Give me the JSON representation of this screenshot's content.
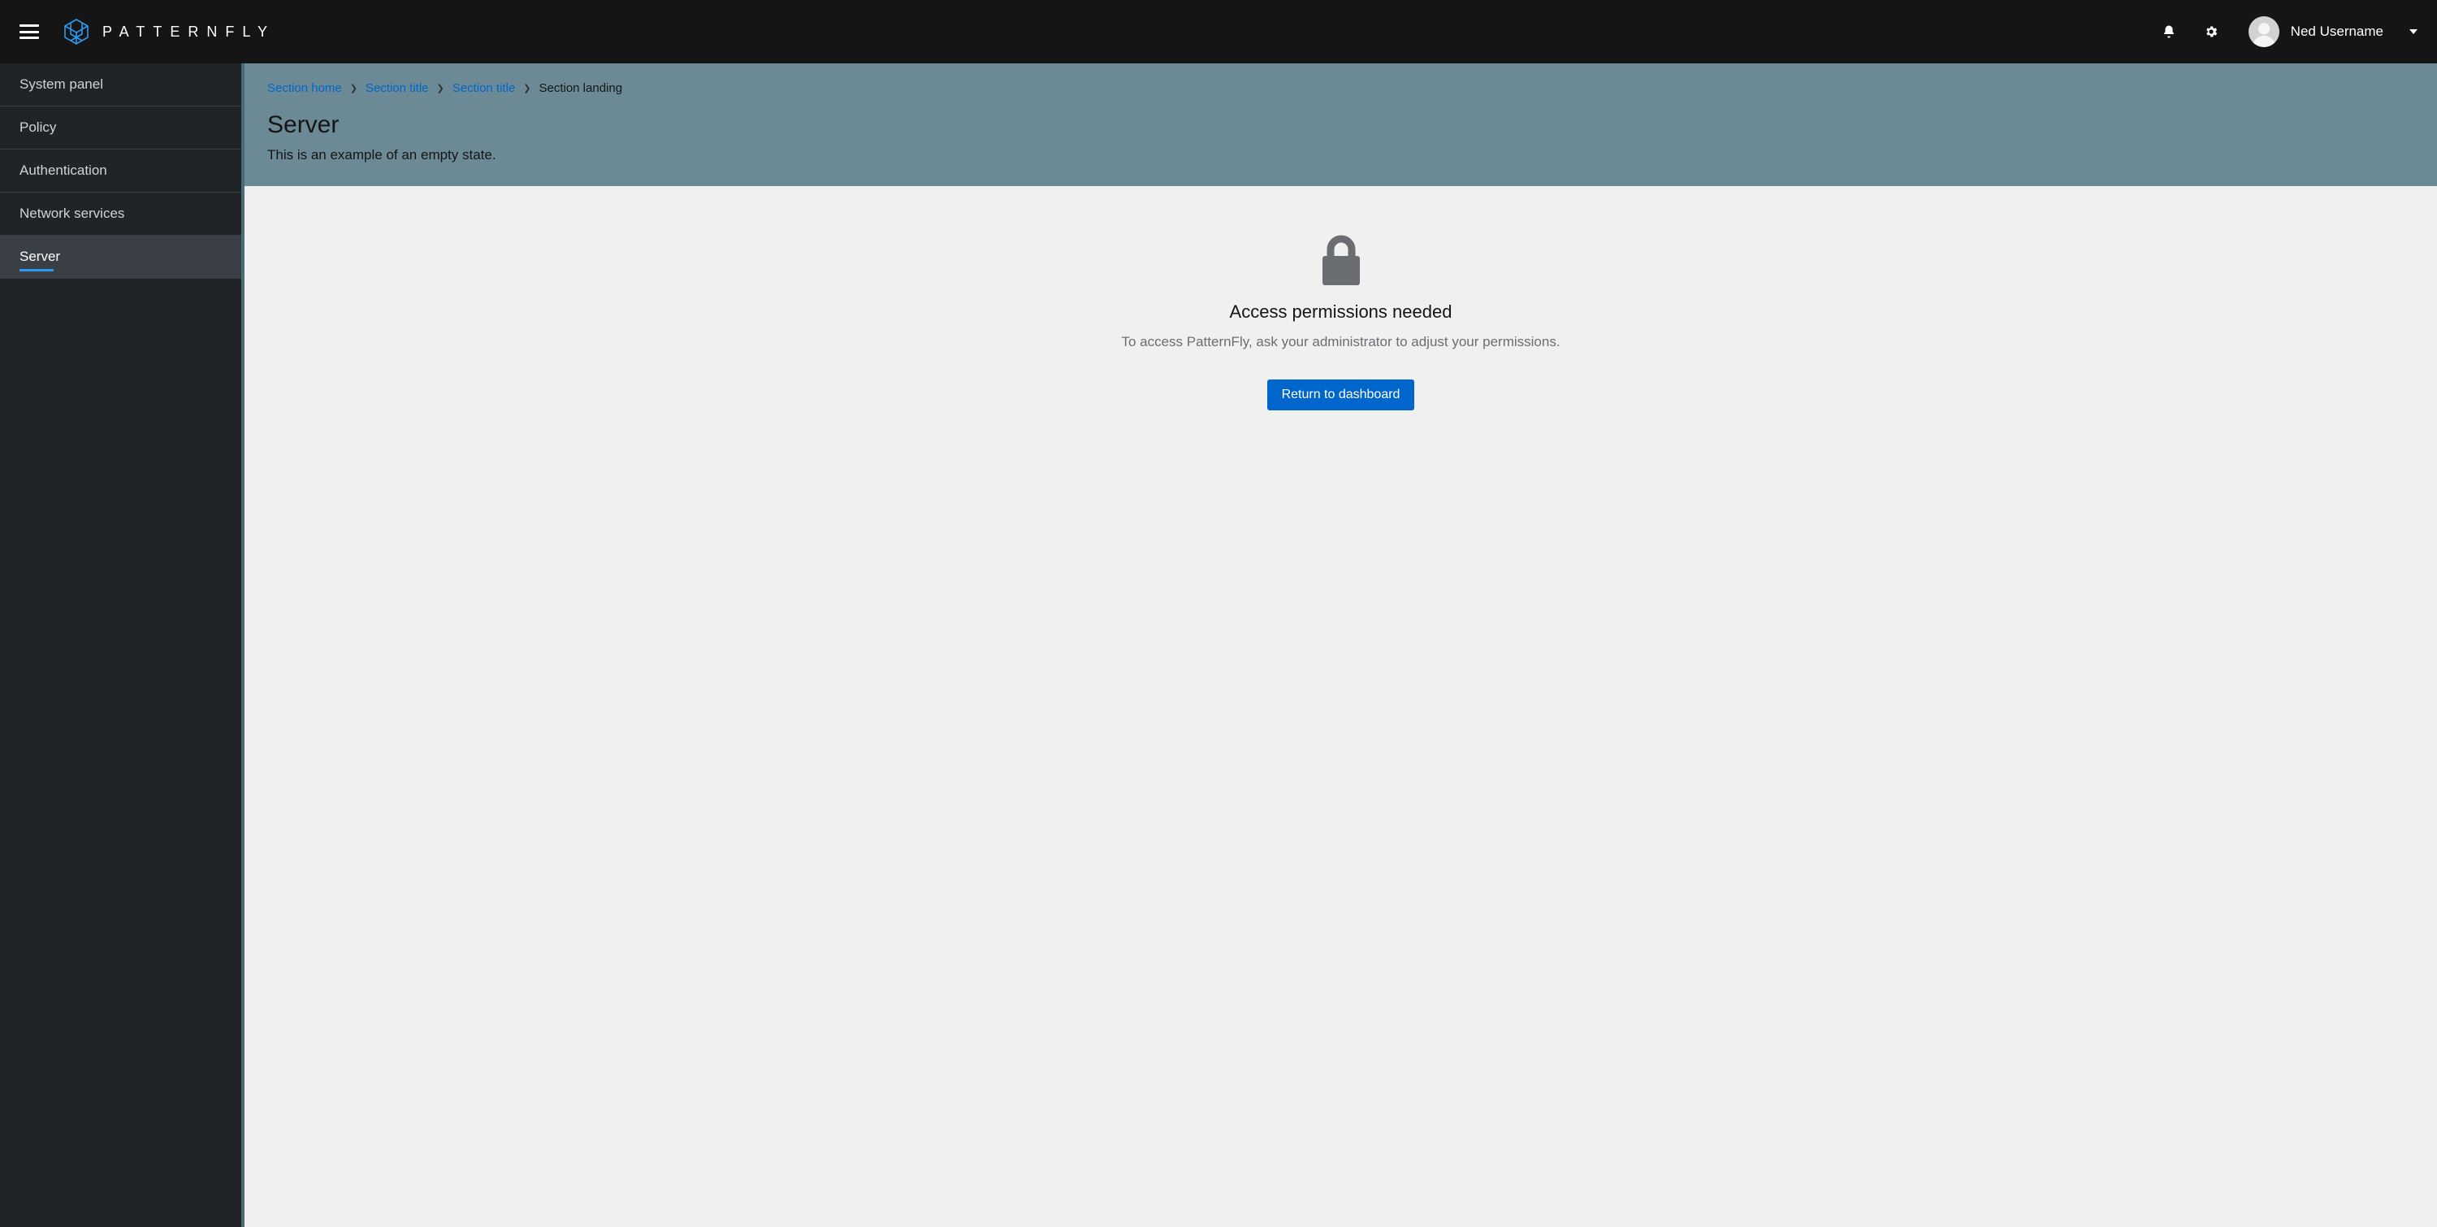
{
  "header": {
    "brand": "PATTERNFLY",
    "username": "Ned Username"
  },
  "sidebar": {
    "items": [
      {
        "label": "System panel"
      },
      {
        "label": "Policy"
      },
      {
        "label": "Authentication"
      },
      {
        "label": "Network services"
      },
      {
        "label": "Server"
      }
    ],
    "active_index": 4
  },
  "breadcrumb": {
    "items": [
      {
        "label": "Section home",
        "link": true
      },
      {
        "label": "Section title",
        "link": true
      },
      {
        "label": "Section title",
        "link": true
      },
      {
        "label": "Section landing",
        "link": false
      }
    ]
  },
  "page": {
    "title": "Server",
    "description": "This is an example of an empty state."
  },
  "empty_state": {
    "title": "Access permissions needed",
    "body": "To access PatternFly, ask your administrator to adjust your permissions.",
    "primary_action": "Return to dashboard"
  }
}
